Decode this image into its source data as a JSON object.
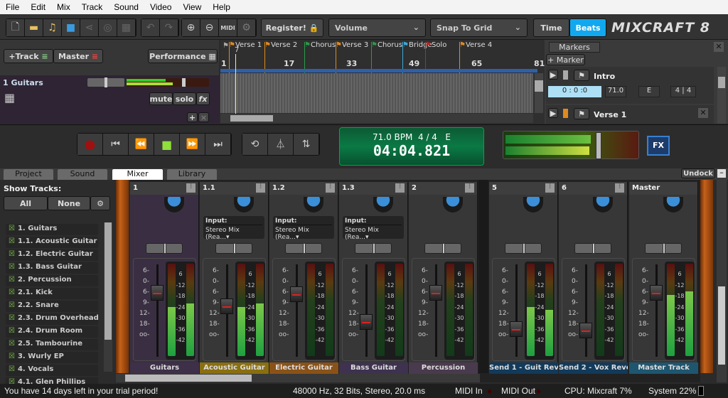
{
  "menu": [
    "File",
    "Edit",
    "Mix",
    "Track",
    "Sound",
    "Video",
    "View",
    "Help"
  ],
  "toolbar": {
    "register": "Register!",
    "volume": "Volume",
    "snap": "Snap To Grid",
    "time": "Time",
    "beats": "Beats",
    "logo": "MIXCRAFT 8",
    "midi": "MIDI"
  },
  "tracks_header": {
    "add_track": "+Track",
    "master": "Master",
    "performance": "Performance"
  },
  "track1": {
    "name": "1 Guitars",
    "mute": "mute",
    "solo": "solo",
    "fx": "fx",
    "add": "+",
    "remove": "×"
  },
  "timeline": {
    "bars": [
      "1",
      "17",
      "33",
      "49",
      "65",
      "81"
    ],
    "playhead_bar": "7",
    "flags": [
      {
        "label": "Verse 1",
        "color": "#e08a1e"
      },
      {
        "label": "Verse 2",
        "color": "#e08a1e"
      },
      {
        "label": "Chorus",
        "color": "#2a9a4a"
      },
      {
        "label": "Verse 3",
        "color": "#e08a1e"
      },
      {
        "label": "Chorus",
        "color": "#2a9a4a"
      },
      {
        "label": "Bridge",
        "color": "#3aa8d8"
      },
      {
        "label": "Solo",
        "color": "#c82020"
      },
      {
        "label": "Verse 4",
        "color": "#e08a1e"
      }
    ]
  },
  "markers": {
    "tab": "Markers",
    "add": "+ Marker",
    "items": [
      {
        "name": "Intro",
        "color": "#aaaaaa",
        "time": "0 : 0 :0",
        "bpm": "71.0",
        "key": "E",
        "sig": "4 | 4"
      },
      {
        "name": "Verse 1",
        "color": "#e08a1e",
        "time": "",
        "bpm": "",
        "key": "",
        "sig": ""
      }
    ]
  },
  "transport": {
    "bpm": "71.0 BPM",
    "sig": "4 / 4",
    "key": "E",
    "time": "04:04.821",
    "fx": "FX"
  },
  "tabs": [
    "Project",
    "Sound",
    "Mixer",
    "Library"
  ],
  "active_tab": "Mixer",
  "undock": "Undock",
  "sidebar": {
    "title": "Show Tracks:",
    "all": "All",
    "none": "None",
    "tracks": [
      "1. Guitars",
      "1.1. Acoustic Guitar",
      "1.2. Electric Guitar",
      "1.3. Bass Guitar",
      "2. Percussion",
      "2.1. Kick",
      "2.2. Snare",
      "2.3. Drum Overhead",
      "2.4. Drum Room",
      "2.5. Tambourine",
      "3. Wurly EP",
      "4. Vocals",
      "4.1. Glen Phillips"
    ]
  },
  "mixer": {
    "input_label": "Input:",
    "input_value": "Stereo Mix (Rea...▾",
    "fader_scale": [
      "6-",
      "0-",
      "6-",
      "9-",
      "12-",
      "18-",
      "oo-"
    ],
    "meter_scale": [
      "6",
      "-12",
      "-18",
      "-24",
      "-30",
      "-36",
      "-42"
    ],
    "channels": [
      {
        "num": "1",
        "label": "Guitars",
        "color": "#3e3048",
        "input": false,
        "fader": 0.76,
        "meter": [
          0.53,
          0.57
        ],
        "bg": "#3a2f42"
      },
      {
        "num": "1.1",
        "label": "Acoustic Guitar",
        "color": "#8a6f10",
        "input": true,
        "fader": 0.6,
        "meter": [
          0.53,
          0.57
        ],
        "bg": "#373737"
      },
      {
        "num": "1.2",
        "label": "Electric Guitar",
        "color": "#8a5218",
        "input": true,
        "fader": 0.74,
        "meter": [
          0,
          0
        ],
        "bg": "#373737"
      },
      {
        "num": "1.3",
        "label": "Bass Guitar",
        "color": "#3e3250",
        "input": true,
        "fader": 0.42,
        "meter": [
          0,
          0
        ],
        "bg": "#373737"
      },
      {
        "num": "2",
        "label": "Percussion",
        "color": "#4a3a4e",
        "input": false,
        "fader": 0.76,
        "meter": [
          0,
          0
        ],
        "bg": "#373737"
      },
      {
        "num": "5",
        "label": "Send 1 - Guit Rev...",
        "color": "#123a5a",
        "input": false,
        "fader": 0.33,
        "meter": [
          0.53,
          0.5
        ],
        "bg": "#373737"
      },
      {
        "num": "6",
        "label": "Send 2 - Vox Reve...",
        "color": "#123a5a",
        "input": false,
        "fader": 0.32,
        "meter": [
          0,
          0
        ],
        "bg": "#373737"
      },
      {
        "num": "Master",
        "label": "Master Track",
        "color": "#1e5670",
        "input": false,
        "fader": 0.76,
        "meter": [
          0.66,
          0.7
        ],
        "bg": "#373737"
      }
    ]
  },
  "status": {
    "trial": "You have 14 days left in your trial period!",
    "audio": "48000 Hz, 32 Bits, Stereo, 20.0 ms",
    "midi_in": "MIDI In",
    "midi_out": "MIDI Out",
    "cpu": "CPU: Mixcraft 7%",
    "system": "System 22%"
  }
}
